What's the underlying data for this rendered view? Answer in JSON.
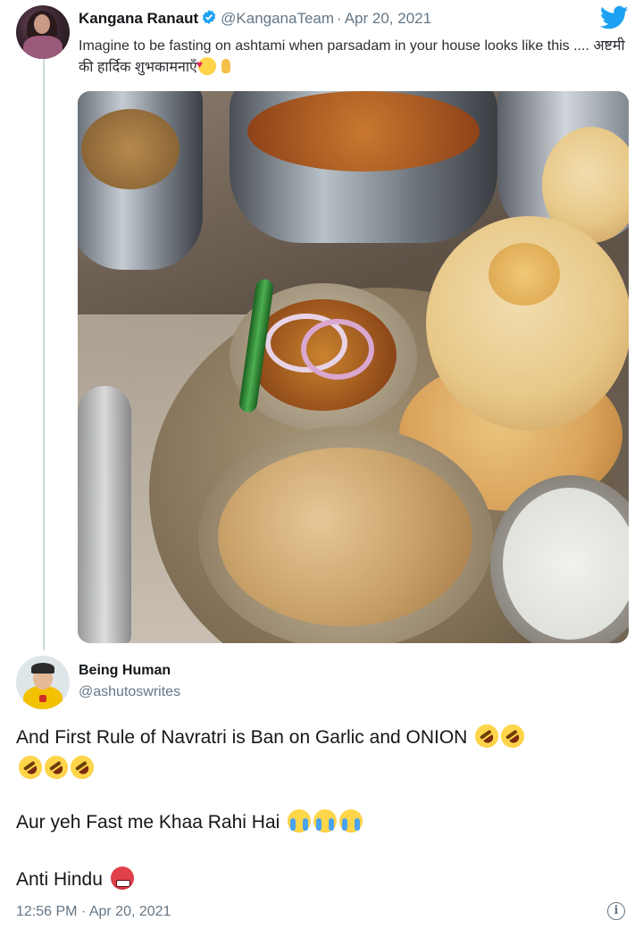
{
  "tweet": {
    "author_name": "Kangana Ranaut",
    "author_handle": "@KanganaTeam",
    "separator": "·",
    "date": "Apr 20, 2021",
    "text": "Imagine to be fasting on ashtami when parsadam in your house looks like this .... अष्टमी की हार्दिक शुभकामनाएँ",
    "emojis": [
      "smiling-face-with-hearts-emoji",
      "folded-hands-emoji"
    ],
    "photo_alt_icon": "food-thali-photo"
  },
  "reply": {
    "author_name": "Being Human",
    "author_handle": "@ashutoswrites",
    "line1": "And First Rule of Navratri is Ban on Garlic and ONION",
    "line2": "Aur yeh Fast me Khaa Rahi Hai",
    "line3": "Anti Hindu",
    "timestamp": "12:56 PM · Apr 20, 2021"
  },
  "colors": {
    "twitter_blue": "#1da1f2",
    "muted_text": "#657786",
    "thread_line": "#cfd9de"
  },
  "icons": {
    "brand": "twitter-bird-icon",
    "verified": "verified-badge-icon",
    "info": "info-icon"
  }
}
